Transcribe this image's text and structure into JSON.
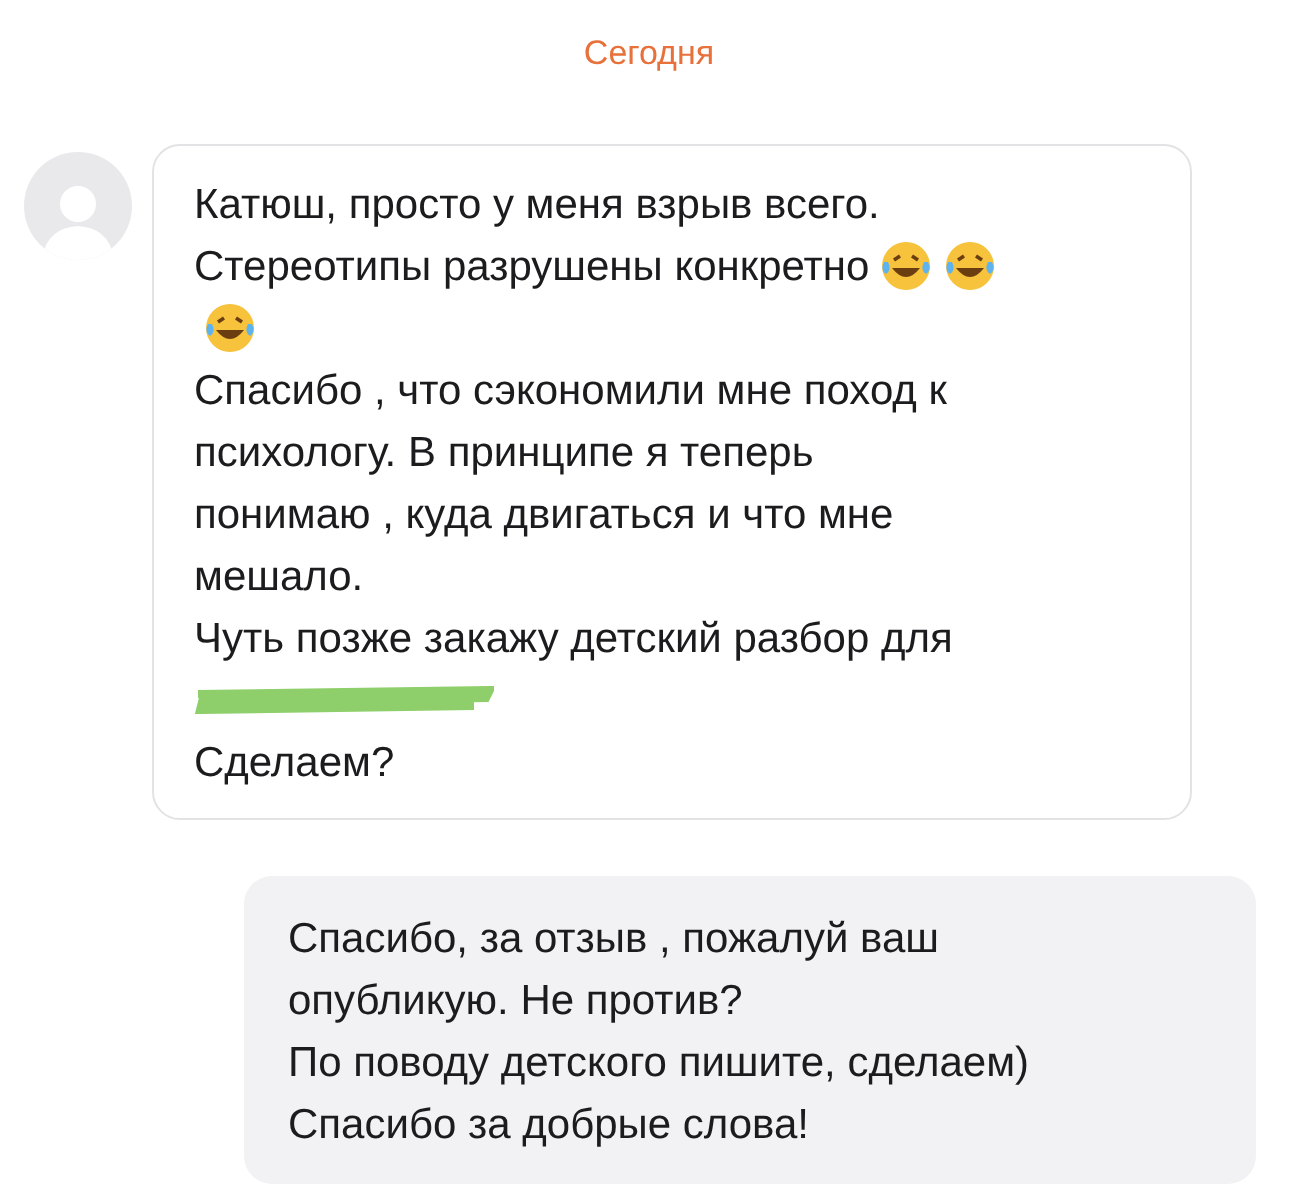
{
  "date_separator": "Сегодня",
  "incoming_message": {
    "lines": [
      {
        "parts": [
          {
            "kind": "text",
            "text": "Катюш, просто у меня взрыв всего."
          }
        ]
      },
      {
        "parts": [
          {
            "kind": "text",
            "text": "Стереотипы разрушены конкретно"
          },
          {
            "kind": "emoji"
          },
          {
            "kind": "emoji"
          }
        ]
      },
      {
        "parts": [
          {
            "kind": "emoji"
          }
        ]
      },
      {
        "parts": [
          {
            "kind": "text",
            "text": "Спасибо , что сэкономили мне поход к"
          }
        ]
      },
      {
        "parts": [
          {
            "kind": "text",
            "text": "психологу. В принципе я теперь"
          }
        ]
      },
      {
        "parts": [
          {
            "kind": "text",
            "text": "понимаю , куда двигаться и что мне"
          }
        ]
      },
      {
        "parts": [
          {
            "kind": "text",
            "text": "мешало."
          }
        ]
      },
      {
        "parts": [
          {
            "kind": "text",
            "text": "Чуть позже закажу детский разбор для"
          }
        ]
      },
      {
        "parts": [
          {
            "kind": "redacted"
          }
        ]
      },
      {
        "parts": [
          {
            "kind": "text",
            "text": "Сделаем?"
          }
        ]
      }
    ]
  },
  "outgoing_message": {
    "lines": [
      "Спасибо, за отзыв , пожалуй ваш",
      "опубликую. Не против?",
      "По поводу детского пишите, сделаем)",
      "Спасибо за добрые слова!"
    ]
  }
}
